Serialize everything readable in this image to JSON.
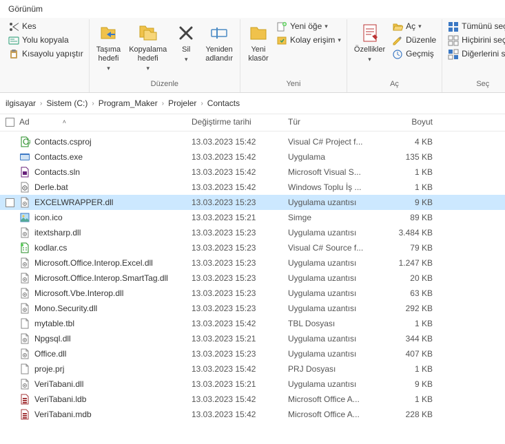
{
  "tab_view": "Görünüm",
  "clipboard": {
    "cut": "Kes",
    "copy_path": "Yolu kopyala",
    "paste_shortcut": "Kısayolu yapıştır"
  },
  "organize": {
    "move_to": "Taşıma\nhedefi",
    "copy_to": "Kopyalama\nhedefi",
    "delete": "Sil",
    "rename": "Yeniden\nadlandır",
    "label": "Düzenle"
  },
  "new": {
    "new_folder": "Yeni\nklasör",
    "new_item": "Yeni öğe",
    "easy_access": "Kolay erişim",
    "label": "Yeni"
  },
  "open": {
    "properties": "Özellikler",
    "open": "Aç",
    "edit": "Düzenle",
    "history": "Geçmiş",
    "label": "Aç"
  },
  "select": {
    "select_all": "Tümünü seç",
    "select_none": "Hiçbirini seçme",
    "invert": "Diğerlerini seç",
    "label": "Seç"
  },
  "breadcrumb": [
    "ilgisayar",
    "Sistem (C:)",
    "Program_Maker",
    "Projeler",
    "Contacts"
  ],
  "columns": {
    "name": "Ad",
    "date": "Değiştirme tarihi",
    "type": "Tür",
    "size": "Boyut"
  },
  "files": [
    {
      "icon": "csproj",
      "name": "Contacts.csproj",
      "date": "13.03.2023 15:42",
      "type": "Visual C# Project f...",
      "size": "4 KB",
      "selected": false
    },
    {
      "icon": "exe",
      "name": "Contacts.exe",
      "date": "13.03.2023 15:42",
      "type": "Uygulama",
      "size": "135 KB",
      "selected": false
    },
    {
      "icon": "sln",
      "name": "Contacts.sln",
      "date": "13.03.2023 15:42",
      "type": "Microsoft Visual S...",
      "size": "1 KB",
      "selected": false
    },
    {
      "icon": "bat",
      "name": "Derle.bat",
      "date": "13.03.2023 15:42",
      "type": "Windows Toplu İş ...",
      "size": "1 KB",
      "selected": false
    },
    {
      "icon": "dll",
      "name": "EXCELWRAPPER.dll",
      "date": "13.03.2023 15:23",
      "type": "Uygulama uzantısı",
      "size": "9 KB",
      "selected": true
    },
    {
      "icon": "ico",
      "name": "icon.ico",
      "date": "13.03.2023 15:21",
      "type": "Simge",
      "size": "89 KB",
      "selected": false
    },
    {
      "icon": "dll",
      "name": "itextsharp.dll",
      "date": "13.03.2023 15:23",
      "type": "Uygulama uzantısı",
      "size": "3.484 KB",
      "selected": false
    },
    {
      "icon": "cs",
      "name": "kodlar.cs",
      "date": "13.03.2023 15:23",
      "type": "Visual C# Source f...",
      "size": "79 KB",
      "selected": false
    },
    {
      "icon": "dll",
      "name": "Microsoft.Office.Interop.Excel.dll",
      "date": "13.03.2023 15:23",
      "type": "Uygulama uzantısı",
      "size": "1.247 KB",
      "selected": false
    },
    {
      "icon": "dll",
      "name": "Microsoft.Office.Interop.SmartTag.dll",
      "date": "13.03.2023 15:23",
      "type": "Uygulama uzantısı",
      "size": "20 KB",
      "selected": false
    },
    {
      "icon": "dll",
      "name": "Microsoft.Vbe.Interop.dll",
      "date": "13.03.2023 15:23",
      "type": "Uygulama uzantısı",
      "size": "63 KB",
      "selected": false
    },
    {
      "icon": "dll",
      "name": "Mono.Security.dll",
      "date": "13.03.2023 15:23",
      "type": "Uygulama uzantısı",
      "size": "292 KB",
      "selected": false
    },
    {
      "icon": "file",
      "name": "mytable.tbl",
      "date": "13.03.2023 15:42",
      "type": "TBL Dosyası",
      "size": "1 KB",
      "selected": false
    },
    {
      "icon": "dll",
      "name": "Npgsql.dll",
      "date": "13.03.2023 15:21",
      "type": "Uygulama uzantısı",
      "size": "344 KB",
      "selected": false
    },
    {
      "icon": "dll",
      "name": "Office.dll",
      "date": "13.03.2023 15:23",
      "type": "Uygulama uzantısı",
      "size": "407 KB",
      "selected": false
    },
    {
      "icon": "file",
      "name": "proje.prj",
      "date": "13.03.2023 15:42",
      "type": "PRJ Dosyası",
      "size": "1 KB",
      "selected": false
    },
    {
      "icon": "dll",
      "name": "VeriTabani.dll",
      "date": "13.03.2023 15:21",
      "type": "Uygulama uzantısı",
      "size": "9 KB",
      "selected": false
    },
    {
      "icon": "mdb",
      "name": "VeriTabani.ldb",
      "date": "13.03.2023 15:42",
      "type": "Microsoft Office A...",
      "size": "1 KB",
      "selected": false
    },
    {
      "icon": "mdb",
      "name": "VeriTabani.mdb",
      "date": "13.03.2023 15:42",
      "type": "Microsoft Office A...",
      "size": "228 KB",
      "selected": false
    }
  ]
}
